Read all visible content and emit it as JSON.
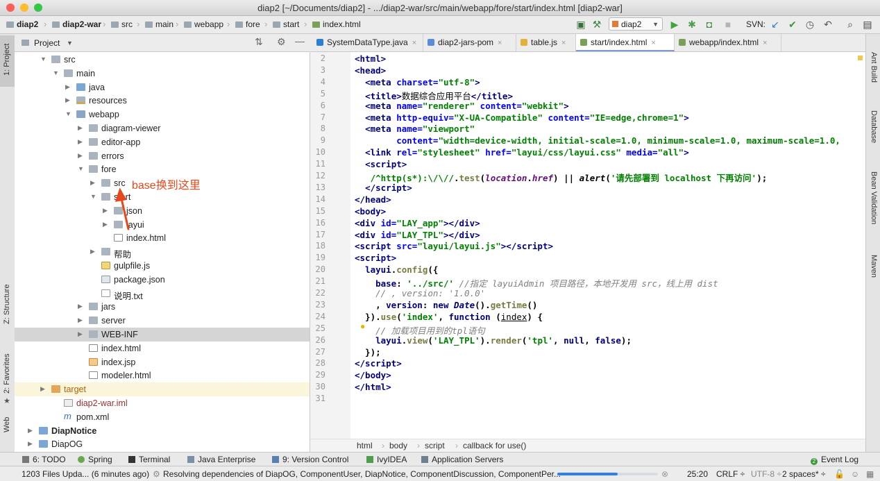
{
  "window": {
    "title": "diap2 [~/Documents/diap2] - .../diap2-war/src/main/webapp/fore/start/index.html [diap2-war]"
  },
  "breadcrumbs": [
    "diap2",
    "diap2-war",
    "src",
    "main",
    "webapp",
    "fore",
    "start",
    "index.html"
  ],
  "toolbar": {
    "run_config": "diap2",
    "svn_label": "SVN:"
  },
  "project_panel": {
    "title": "Project",
    "tree": [
      {
        "label": "src",
        "depth": 1,
        "arrow": "down",
        "icon": "folder"
      },
      {
        "label": "main",
        "depth": 2,
        "arrow": "down",
        "icon": "folder"
      },
      {
        "label": "java",
        "depth": 3,
        "arrow": "right",
        "icon": "folder-src"
      },
      {
        "label": "resources",
        "depth": 3,
        "arrow": "right",
        "icon": "folder-res"
      },
      {
        "label": "webapp",
        "depth": 3,
        "arrow": "down",
        "icon": "folder-web"
      },
      {
        "label": "diagram-viewer",
        "depth": 4,
        "arrow": "right",
        "icon": "folder"
      },
      {
        "label": "editor-app",
        "depth": 4,
        "arrow": "right",
        "icon": "folder"
      },
      {
        "label": "errors",
        "depth": 4,
        "arrow": "right",
        "icon": "folder"
      },
      {
        "label": "fore",
        "depth": 4,
        "arrow": "down",
        "icon": "folder"
      },
      {
        "label": "src",
        "depth": 5,
        "arrow": "right",
        "icon": "folder"
      },
      {
        "label": "start",
        "depth": 5,
        "arrow": "down",
        "icon": "folder"
      },
      {
        "label": "json",
        "depth": 6,
        "arrow": "right",
        "icon": "folder"
      },
      {
        "label": "layui",
        "depth": 6,
        "arrow": "right",
        "icon": "folder"
      },
      {
        "label": "index.html",
        "depth": 6,
        "arrow": "",
        "icon": "html"
      },
      {
        "label": "帮助",
        "depth": 5,
        "arrow": "right",
        "icon": "folder"
      },
      {
        "label": "gulpfile.js",
        "depth": 5,
        "arrow": "",
        "icon": "js"
      },
      {
        "label": "package.json",
        "depth": 5,
        "arrow": "",
        "icon": "json"
      },
      {
        "label": "说明.txt",
        "depth": 5,
        "arrow": "",
        "icon": "txt"
      },
      {
        "label": "jars",
        "depth": 4,
        "arrow": "right",
        "icon": "folder"
      },
      {
        "label": "server",
        "depth": 4,
        "arrow": "right",
        "icon": "folder"
      },
      {
        "label": "WEB-INF",
        "depth": 4,
        "arrow": "right",
        "icon": "folder",
        "selected": true
      },
      {
        "label": "index.html",
        "depth": 4,
        "arrow": "",
        "icon": "html"
      },
      {
        "label": "index.jsp",
        "depth": 4,
        "arrow": "",
        "icon": "jsp"
      },
      {
        "label": "modeler.html",
        "depth": 4,
        "arrow": "",
        "icon": "html"
      },
      {
        "label": "target",
        "depth": 1,
        "arrow": "right",
        "icon": "folder-target",
        "highlight": true,
        "color": "#b26400"
      },
      {
        "label": "diap2-war.iml",
        "depth": 2,
        "arrow": "",
        "icon": "iml",
        "color": "#9a3030"
      },
      {
        "label": "pom.xml",
        "depth": 2,
        "arrow": "",
        "icon": "maven"
      },
      {
        "label": "DiapNotice",
        "depth": 0,
        "arrow": "right",
        "icon": "module",
        "bold": true
      },
      {
        "label": "DiapOG",
        "depth": 0,
        "arrow": "right",
        "icon": "module"
      }
    ]
  },
  "annotation": {
    "text": "base换到这里"
  },
  "tabs": [
    {
      "label": "SystemDataType.java",
      "icon_color": "#2d7dd2",
      "active": false
    },
    {
      "label": "diap2-jars-pom",
      "icon_color": "#5a8dd6",
      "active": false
    },
    {
      "label": "table.js",
      "icon_color": "#e0b23a",
      "active": false
    },
    {
      "label": "start/index.html",
      "icon_color": "#7aa05a",
      "active": true
    },
    {
      "label": "webapp/index.html",
      "icon_color": "#7aa05a",
      "active": false
    }
  ],
  "editor": {
    "lines": [
      {
        "n": "2",
        "html": "<span class='t'>&lt;html&gt;</span>"
      },
      {
        "n": "3",
        "html": "<span class='t'>&lt;head&gt;</span>"
      },
      {
        "n": "4",
        "html": "  <span class='t'>&lt;meta</span> <span class='a'>charset=</span><span class='s'>\"utf-8\"</span><span class='t'>&gt;</span>"
      },
      {
        "n": "5",
        "html": "  <span class='t'>&lt;title&gt;</span><span style='font-weight:normal'>数据综合应用平台</span><span class='t'>&lt;/title&gt;</span>"
      },
      {
        "n": "6",
        "html": "  <span class='t'>&lt;meta</span> <span class='a'>name=</span><span class='s'>\"renderer\"</span> <span class='a'>content=</span><span class='s'>\"webkit\"</span><span class='t'>&gt;</span>"
      },
      {
        "n": "7",
        "html": "  <span class='t'>&lt;meta</span> <span class='a'>http-equiv=</span><span class='s'>\"X-UA-Compatible\"</span> <span class='a'>content=</span><span class='s'>\"IE=edge,chrome=1\"</span><span class='t'>&gt;</span>"
      },
      {
        "n": "8",
        "html": "  <span class='t'>&lt;meta</span> <span class='a'>name=</span><span class='s'>\"viewport\"</span>"
      },
      {
        "n": "9",
        "html": "        <span class='a'>content=</span><span class='s'>\"width=device-width, initial-scale=1.0, minimum-scale=1.0, maximum-scale=1.0,</span>"
      },
      {
        "n": "10",
        "html": "  <span class='t'>&lt;link</span> <span class='a'>rel=</span><span class='s'>\"stylesheet\"</span> <span class='a'>href=</span><span class='s'>\"layui/css/layui.css\"</span> <span class='a'>media=</span><span class='s'>\"all\"</span><span class='t'>&gt;</span>"
      },
      {
        "n": "11",
        "html": "  <span class='t'>&lt;script&gt;</span>"
      },
      {
        "n": "12",
        "html": "   <span class='s'>/^http(s*):\\/\\//</span>.<span class='f'>test</span>(<span class='i'>location</span>.<span class='i' style='color:#660e7a'>href</span>) || <span class='i' style='color:#000'>alert</span>(<span class='s'>'请先部署到 localhost 下再访问'</span>);"
      },
      {
        "n": "13",
        "html": "  <span class='t'>&lt;/script&gt;</span>"
      },
      {
        "n": "14",
        "html": "<span class='t'>&lt;/head&gt;</span>"
      },
      {
        "n": "15",
        "html": "<span class='t'>&lt;body&gt;</span>"
      },
      {
        "n": "16",
        "html": "<span class='t'>&lt;div</span> <span class='a'>id=</span><span class='s'>\"LAY_app\"</span><span class='t'>&gt;&lt;/div&gt;</span>"
      },
      {
        "n": "17",
        "html": "<span class='t'>&lt;div</span> <span class='a'>id=</span><span class='s'>\"LAY_TPL\"</span><span class='t'>&gt;&lt;/div&gt;</span>"
      },
      {
        "n": "18",
        "html": "<span class='t'>&lt;script</span> <span class='a'>src=</span><span class='s'>\"layui/layui.js\"</span><span class='t'>&gt;&lt;/script&gt;</span>"
      },
      {
        "n": "19",
        "html": "<span class='t'>&lt;script&gt;</span>"
      },
      {
        "n": "20",
        "html": "  <span class='k'>layui</span>.<span class='f'>config</span>({"
      },
      {
        "n": "21",
        "html": "    <span class='k'>base</span>: <span class='s'>'../src/'</span> <span class='c'>//指定 layuiAdmin 项目路径，本地开发用 src，线上用 dist</span>"
      },
      {
        "n": "22",
        "html": "    <span class='c'>// , version: '1.0.0'</span>"
      },
      {
        "n": "23",
        "html": "    , <span class='k'>version</span>: <span class='k'>new</span> <span class='i' style='color:#000080'>Date</span>().<span class='f'>getTime</span>()"
      },
      {
        "n": "24",
        "html": "  }).<span class='f'>use</span>(<span class='s'>'index'</span>, <span class='k'>function</span> (<span style='font-weight:normal;text-decoration:underline'>index</span>) {"
      },
      {
        "n": "25",
        "html": "    <span class='c'>// 加载项目用到的tpl语句</span>"
      },
      {
        "n": "26",
        "html": "    <span class='k'>layui</span>.<span class='f'>view</span>(<span class='s'>'LAY_TPL'</span>).<span class='f'>render</span>(<span class='s'>'tpl'</span>, <span class='k'>null</span>, <span class='k'>false</span>);"
      },
      {
        "n": "27",
        "html": "  });"
      },
      {
        "n": "28",
        "html": "<span class='t'>&lt;/script&gt;</span>"
      },
      {
        "n": "29",
        "html": "<span class='t'>&lt;/body&gt;</span>"
      },
      {
        "n": "30",
        "html": "<span class='t'>&lt;/html&gt;</span>"
      },
      {
        "n": "31",
        "html": ""
      }
    ],
    "breadcrumb": [
      "html",
      "body",
      "script",
      "callback for use()"
    ]
  },
  "left_strip": [
    "1: Project",
    "Z: Structure",
    "2: Favorites",
    "Web"
  ],
  "right_strip": [
    "Ant Build",
    "Database",
    "Bean Validation",
    "Maven"
  ],
  "bottom_tools": [
    "6: TODO",
    "Spring",
    "Terminal",
    "Java Enterprise",
    "9: Version Control",
    "IvyIDEA",
    "Application Servers",
    "Event Log"
  ],
  "status": {
    "message": "1203 Files Upda... (6 minutes ago)",
    "task": "Resolving dependencies of DiapOG, ComponentUser, DiapNotice, ComponentDiscussion, ComponentPer...",
    "position": "25:20",
    "line_sep": "CRLF ÷",
    "encoding": "UTF-8 ÷",
    "indent": "2 spaces* ÷",
    "event_count": "2"
  }
}
